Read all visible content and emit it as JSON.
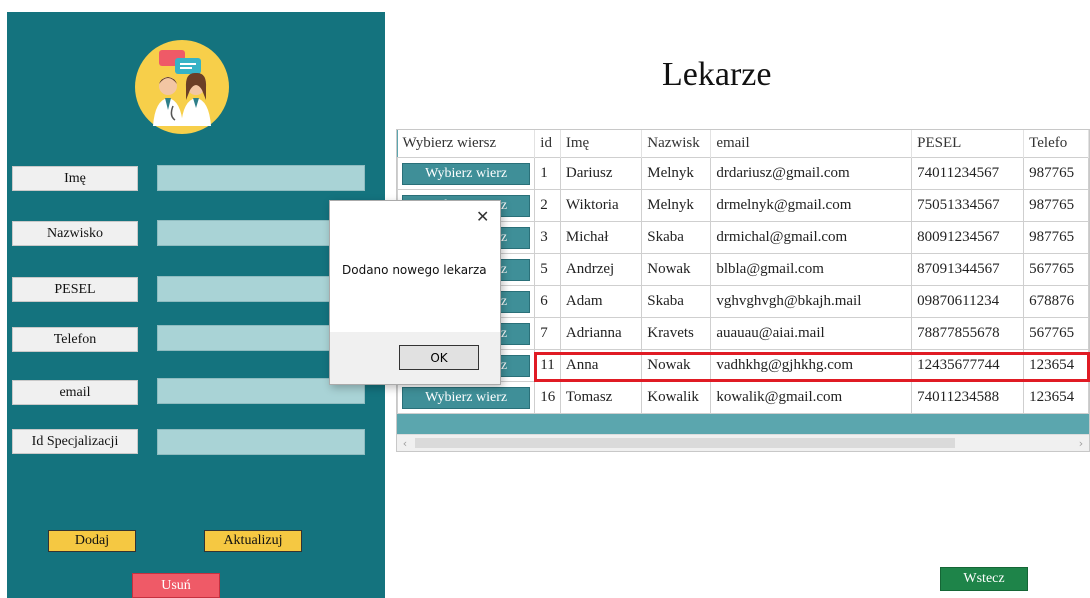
{
  "form": {
    "fields": [
      {
        "label": "Imę",
        "value": ""
      },
      {
        "label": "Nazwisko",
        "value": ""
      },
      {
        "label": "PESEL",
        "value": ""
      },
      {
        "label": "Telefon",
        "value": ""
      },
      {
        "label": "email",
        "value": ""
      },
      {
        "label": "Id Specjalizacji",
        "value": ""
      }
    ],
    "add_label": "Dodaj",
    "update_label": "Aktualizuj",
    "delete_label": "Usuń"
  },
  "page_title": "Lekarze",
  "grid": {
    "columns": [
      "Wybierz wiersz",
      "id",
      "Imę",
      "Nazwisk",
      "email",
      "PESEL",
      "Telefo"
    ],
    "row_button_label": "Wybierz wierz",
    "rows": [
      [
        "1",
        "Dariusz",
        "Melnyk",
        "drdariusz@gmail.com",
        "74011234567",
        "987765"
      ],
      [
        "2",
        "Wiktoria",
        "Melnyk",
        "drmelnyk@gmail.com",
        "75051334567",
        "987765"
      ],
      [
        "3",
        "Michał",
        "Skaba",
        "drmichal@gmail.com",
        "80091234567",
        "987765"
      ],
      [
        "5",
        "Andrzej",
        "Nowak",
        "blbla@gmail.com",
        "87091344567",
        "567765"
      ],
      [
        "6",
        "Adam",
        "Skaba",
        "vghvghvgh@bkajh.mail",
        "09870611234",
        "678876"
      ],
      [
        "7",
        "Adrianna",
        "Kravets",
        "auauau@aiai.mail",
        "78877855678",
        "567765"
      ],
      [
        "11",
        "Anna",
        "Nowak",
        "vadhkhg@gjhkhg.com",
        "12435677744",
        "123654"
      ],
      [
        "16",
        "Tomasz",
        "Kowalik",
        "kowalik@gmail.com",
        "74011234588",
        "123654"
      ]
    ]
  },
  "dialog": {
    "message": "Dodano nowego lekarza",
    "ok_label": "OK",
    "close_glyph": "✕"
  },
  "back_label": "Wstecz",
  "colors": {
    "sidebar": "#14737e",
    "input": "#a9d3d6",
    "accent_yellow": "#f5c842",
    "danger": "#ef5a67",
    "back_green": "#1e8449",
    "highlight": "#e01b24"
  }
}
